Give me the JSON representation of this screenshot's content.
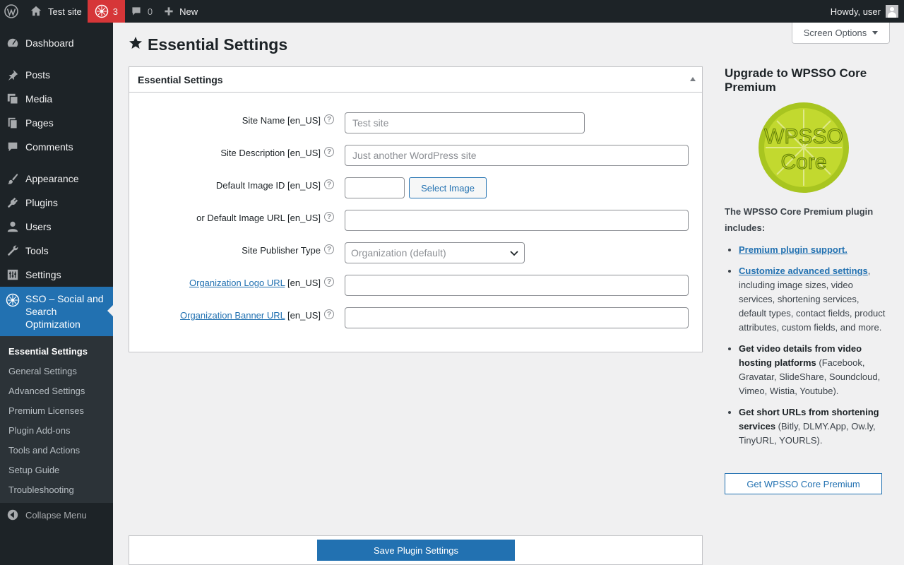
{
  "adminbar": {
    "site_name": "Test site",
    "notifications_count": "3",
    "comments_count": "0",
    "new_label": "New",
    "howdy": "Howdy, user"
  },
  "sidebar": {
    "items": [
      {
        "label": "Dashboard",
        "icon": "dashboard-icon"
      },
      {
        "label": "Posts",
        "icon": "pin-icon"
      },
      {
        "label": "Media",
        "icon": "media-icon"
      },
      {
        "label": "Pages",
        "icon": "pages-icon"
      },
      {
        "label": "Comments",
        "icon": "comment-icon"
      },
      {
        "label": "Appearance",
        "icon": "brush-icon"
      },
      {
        "label": "Plugins",
        "icon": "plug-icon"
      },
      {
        "label": "Users",
        "icon": "user-icon"
      },
      {
        "label": "Tools",
        "icon": "wrench-icon"
      },
      {
        "label": "Settings",
        "icon": "sliders-icon"
      }
    ],
    "active": {
      "label": "SSO – Social and Search Optimization",
      "icon": "sso-icon"
    },
    "submenu": [
      "Essential Settings",
      "General Settings",
      "Advanced Settings",
      "Premium Licenses",
      "Plugin Add-ons",
      "Tools and Actions",
      "Setup Guide",
      "Troubleshooting"
    ],
    "collapse_label": "Collapse Menu"
  },
  "screen_options": "Screen Options",
  "page_title": "Essential Settings",
  "settings_box": {
    "title": "Essential Settings",
    "site_name_label": "Site Name [en_US]",
    "site_name_placeholder": "Test site",
    "site_description_label": "Site Description [en_US]",
    "site_description_placeholder": "Just another WordPress site",
    "default_image_id_label": "Default Image ID [en_US]",
    "select_image_label": "Select Image",
    "default_image_url_label": "or Default Image URL [en_US]",
    "site_publisher_type_label": "Site Publisher Type",
    "site_publisher_type_value": "Organization (default)",
    "org_logo_link": "Organization Logo URL",
    "org_banner_link": "Organization Banner URL",
    "locale_suffix": "[en_US]",
    "help_glyph": "?"
  },
  "save_button": "Save Plugin Settings",
  "upgrade": {
    "title": "Upgrade to WPSSO Core Premium",
    "logo_text_1": "WPSSO",
    "logo_text_2": "Core",
    "intro": "The WPSSO Core Premium plugin includes:",
    "features": [
      {
        "link": "Premium plugin support.",
        "rest": ""
      },
      {
        "link": "Customize advanced settings",
        "rest": ", including image sizes, video services, shortening services, default types, contact fields, product attributes, custom fields, and more."
      },
      {
        "bold": "Get video details from video hosting platforms",
        "rest": " (Facebook, Gravatar, SlideShare, Soundcloud, Vimeo, Wistia, Youtube)."
      },
      {
        "bold": "Get short URLs from shortening services",
        "rest": " (Bitly, DLMY.App, Ow.ly, TinyURL, YOURLS)."
      }
    ],
    "button": "Get WPSSO Core Premium"
  }
}
